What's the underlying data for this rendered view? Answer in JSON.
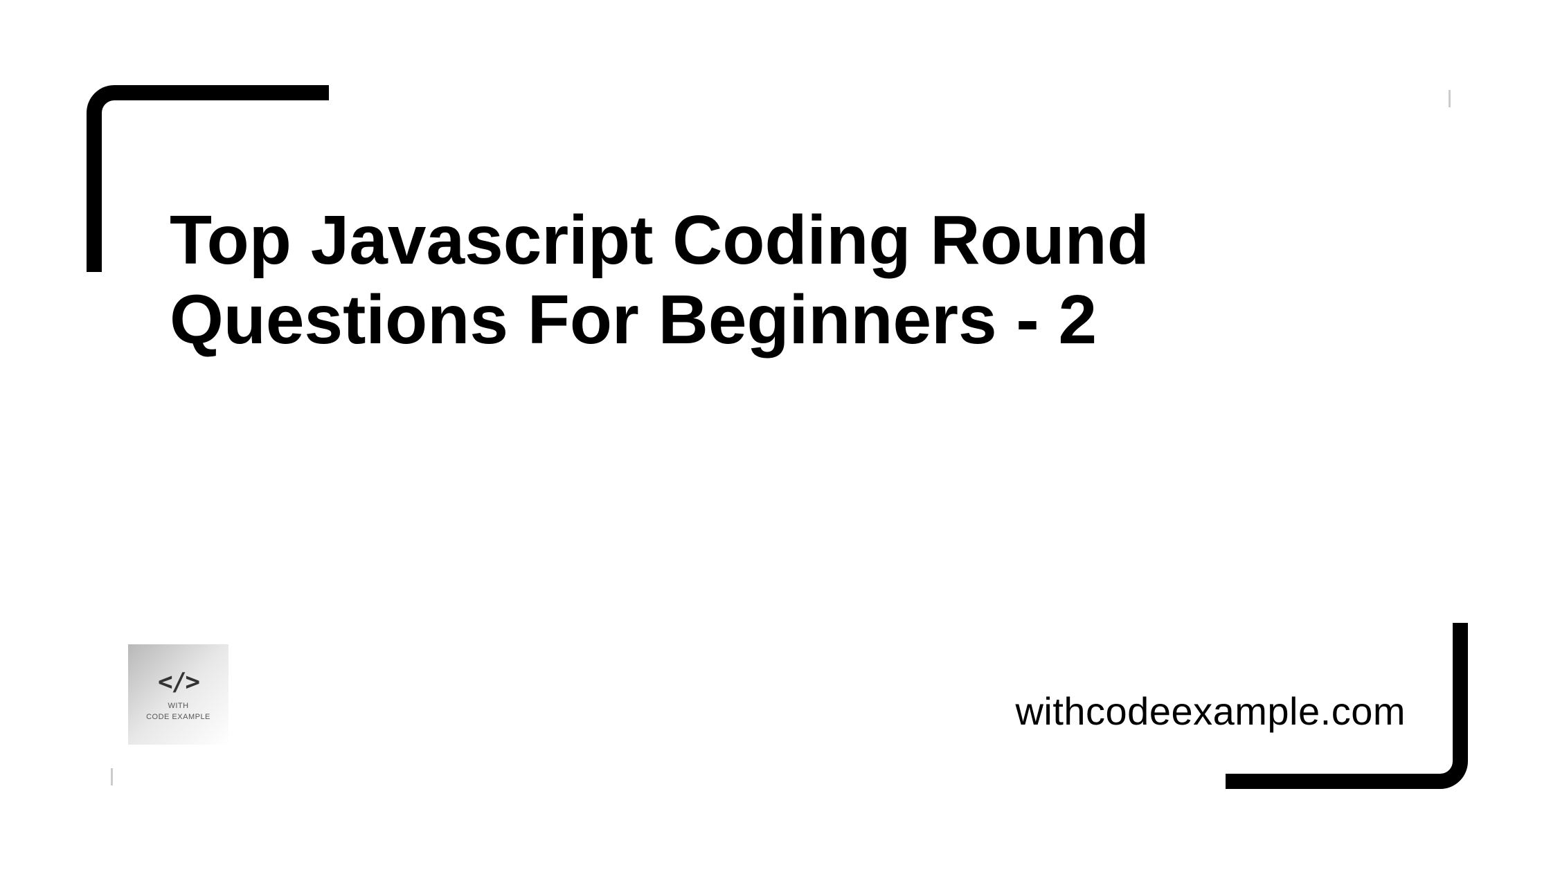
{
  "title": "Top Javascript Coding Round Questions For Beginners - 2",
  "logo": {
    "icon_text": "</>",
    "line1": "WITH",
    "line2": "CODE EXAMPLE"
  },
  "website": "withcodeexample.com"
}
